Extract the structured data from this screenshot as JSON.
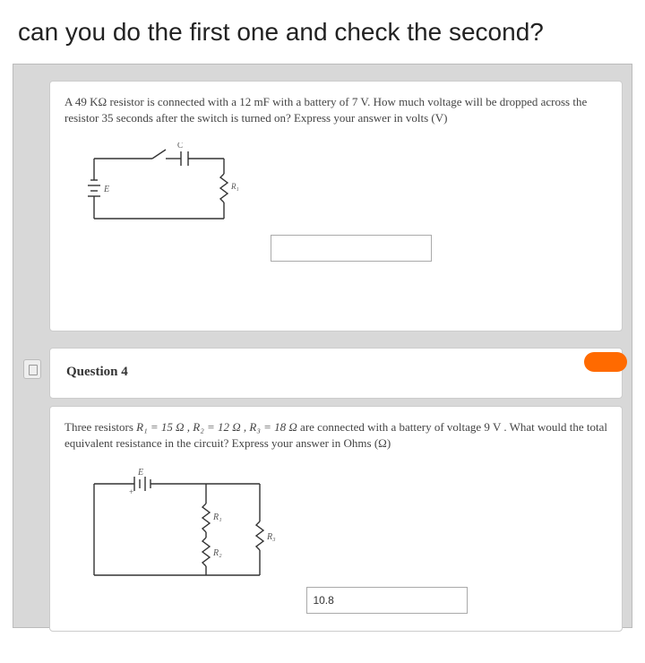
{
  "title": "can you do the first one and check the second?",
  "q3": {
    "text_a": "A 49 KΩ resistor is connected with a 12 mF with a battery of 7 V. How much voltage will be dropped across the resistor 35 seconds after the switch is turned on? Express your answer in volts (V)",
    "labels": {
      "E": "E",
      "C": "C",
      "R1": "R₁"
    },
    "answer": ""
  },
  "q4": {
    "header": "Question 4",
    "text_a_prefix": "Three resistors ",
    "eq": "R₁ = 15 Ω , R₂ = 12 Ω , R₃ = 18 Ω",
    "text_a_suffix": " are connected with a battery of voltage 9 V . What would the total equivalent resistance in the circuit? Express your answer in Ohms (Ω)",
    "labels": {
      "E": "E",
      "R1": "R₁",
      "R2": "R₂",
      "R3": "R₃"
    },
    "answer": "10.8"
  }
}
